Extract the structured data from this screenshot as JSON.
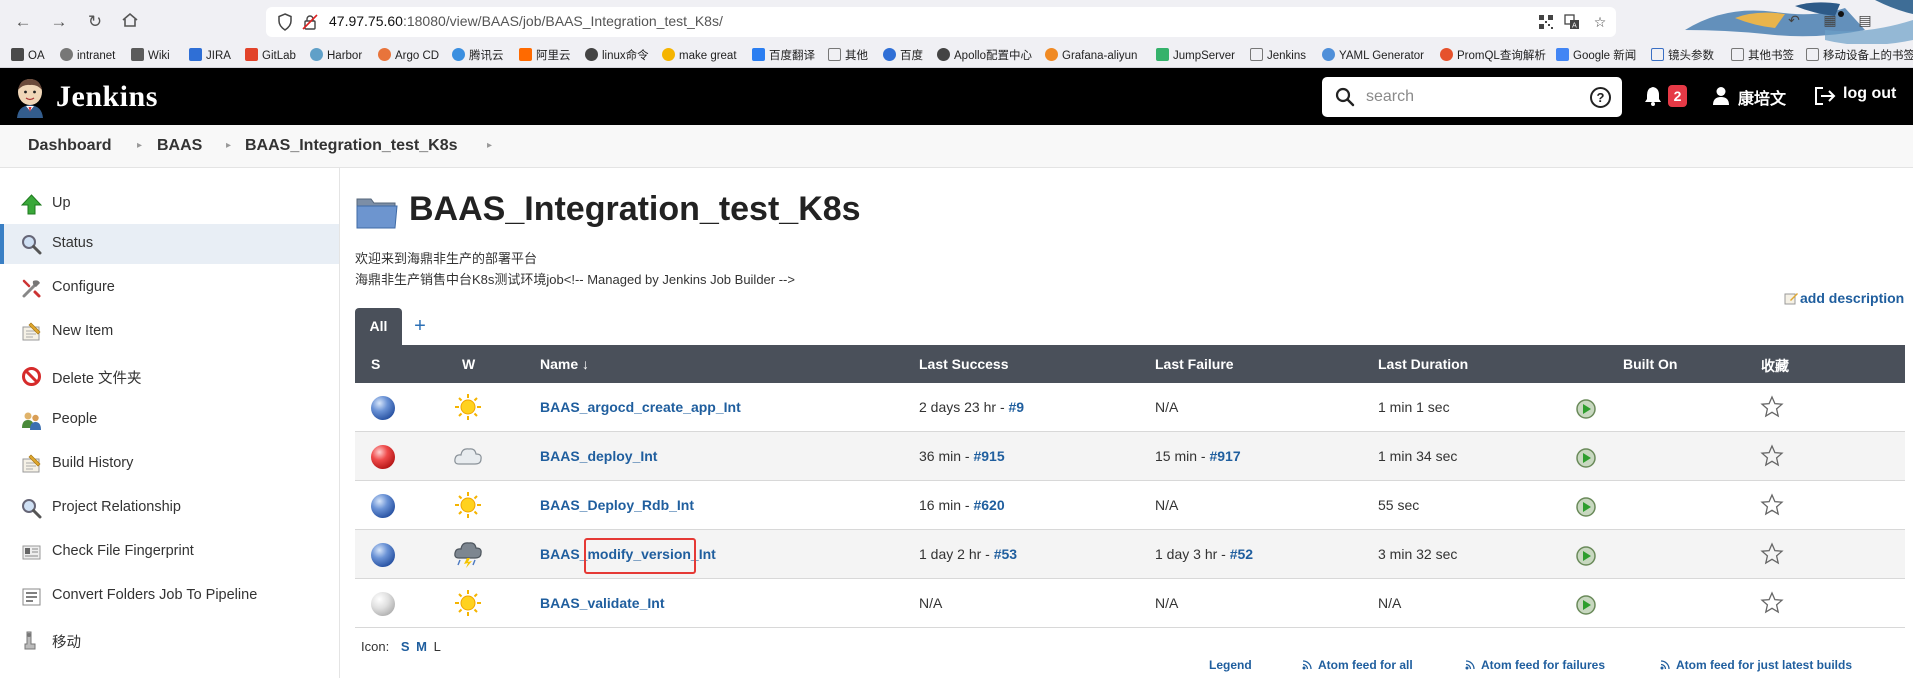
{
  "browser": {
    "url_host": "47.97.75.60",
    "url_rest": ":18080/view/BAAS/job/BAAS_Integration_test_K8s/"
  },
  "bookmarks": [
    {
      "label": "OA",
      "color": "#4a4a4a"
    },
    {
      "label": "intranet",
      "color": "#666666"
    },
    {
      "label": "Wiki",
      "color": "#5b5b5b"
    },
    {
      "label": "JIRA",
      "color": "#2f6fd6"
    },
    {
      "label": "GitLab",
      "color": "#e2432a"
    },
    {
      "label": "Harbor",
      "color": "#60a0c8"
    },
    {
      "label": "Argo CD",
      "color": "#e8743b"
    },
    {
      "label": "腾讯云",
      "color": "#3b8fe0"
    },
    {
      "label": "阿里云",
      "color": "#ff6a00"
    },
    {
      "label": "linux命令",
      "color": "#444444"
    },
    {
      "label": "make great",
      "color": "#f5b400"
    },
    {
      "label": "百度翻译",
      "color": "#2b7ef1"
    },
    {
      "label": "其他",
      "color": "#777777"
    },
    {
      "label": "百度",
      "color": "#2f6fd6"
    },
    {
      "label": "Apollo配置中心",
      "color": "#444444"
    },
    {
      "label": "Grafana-aliyun",
      "color": "#f08a24"
    },
    {
      "label": "JumpServer",
      "color": "#35b26b"
    },
    {
      "label": "Jenkins",
      "color": "#777777"
    },
    {
      "label": "YAML Generator",
      "color": "#4f8fd9"
    },
    {
      "label": "PromQL查询解析",
      "color": "#e6522c"
    },
    {
      "label": "Google 新闻",
      "color": "#4285f4"
    },
    {
      "label": "镜头参数",
      "color": "#3a6fc4"
    },
    {
      "label": "其他书签",
      "color": "#777777"
    },
    {
      "label": "移动设备上的书签",
      "color": "#777777"
    }
  ],
  "header": {
    "title": "Jenkins",
    "search_placeholder": "search",
    "help_glyph": "?",
    "notification_count": "2",
    "user_name": "康培文",
    "logout_label": "log out"
  },
  "breadcrumb": {
    "items": [
      "Dashboard",
      "BAAS",
      "BAAS_Integration_test_K8s"
    ]
  },
  "sidebar": {
    "items": [
      {
        "label": "Up",
        "icon": "up-arrow-icon"
      },
      {
        "label": "Status",
        "icon": "magnifier-icon"
      },
      {
        "label": "Configure",
        "icon": "tools-icon"
      },
      {
        "label": "New Item",
        "icon": "notepad-icon"
      },
      {
        "label": "Delete 文件夹",
        "icon": "no-entry-icon"
      },
      {
        "label": "People",
        "icon": "people-icon"
      },
      {
        "label": "Build History",
        "icon": "notepad-icon"
      },
      {
        "label": "Project Relationship",
        "icon": "magnifier-icon"
      },
      {
        "label": "Check File Fingerprint",
        "icon": "fingerprint-icon"
      },
      {
        "label": "Convert Folders Job To Pipeline",
        "icon": "pipeline-icon"
      },
      {
        "label": "移动",
        "icon": "move-icon"
      }
    ]
  },
  "main": {
    "title": "BAAS_Integration_test_K8s",
    "description_line1": "欢迎来到海鼎非生产的部署平台",
    "description_line2": "海鼎非生产销售中台K8s测试环境job<!-- Managed by Jenkins Job Builder -->",
    "add_description": "add description",
    "tab_all": "All",
    "tab_add": "+"
  },
  "table": {
    "headers": {
      "s": "S",
      "w": "W",
      "name": "Name ↓",
      "last_success": "Last Success",
      "last_failure": "Last Failure",
      "last_duration": "Last Duration",
      "built_on": "Built On",
      "fav": "收藏"
    },
    "rows": [
      {
        "status": "blue",
        "weather": "sunny",
        "name": "BAAS_argocd_create_app_Int",
        "success_text": "2 days 23 hr - ",
        "success_link": "#9",
        "failure_text": "N/A",
        "failure_link": "",
        "duration": "1 min 1 sec"
      },
      {
        "status": "red",
        "weather": "cloudy",
        "name": "BAAS_deploy_Int",
        "success_text": "36 min - ",
        "success_link": "#915",
        "failure_text": "15 min - ",
        "failure_link": "#917",
        "duration": "1 min 34 sec"
      },
      {
        "status": "blue",
        "weather": "sunny",
        "name": "BAAS_Deploy_Rdb_Int",
        "success_text": "16 min - ",
        "success_link": "#620",
        "failure_text": "N/A",
        "failure_link": "",
        "duration": "55 sec"
      },
      {
        "status": "blue",
        "weather": "thunderstorm",
        "name": "BAAS_modify_version_Int",
        "success_text": "1 day 2 hr - ",
        "success_link": "#53",
        "failure_text": "1 day 3 hr - ",
        "failure_link": "#52",
        "duration": "3 min 32 sec"
      },
      {
        "status": "grey",
        "weather": "sunny",
        "name": "BAAS_validate_Int",
        "success_text": "N/A",
        "success_link": "",
        "failure_text": "N/A",
        "failure_link": "",
        "duration": "N/A"
      }
    ]
  },
  "footer": {
    "icon_label": "Icon:",
    "sizes": [
      "S",
      "M",
      "L"
    ],
    "legend": "Legend",
    "atom_all": "Atom feed for all",
    "atom_failures": "Atom feed for failures",
    "atom_latest": "Atom feed for just latest builds"
  },
  "colors": {
    "header_bg": "#000000",
    "table_header_bg": "#4a505a",
    "link": "#1f5e9e",
    "badge": "#e63946",
    "highlight": "#e53935"
  }
}
